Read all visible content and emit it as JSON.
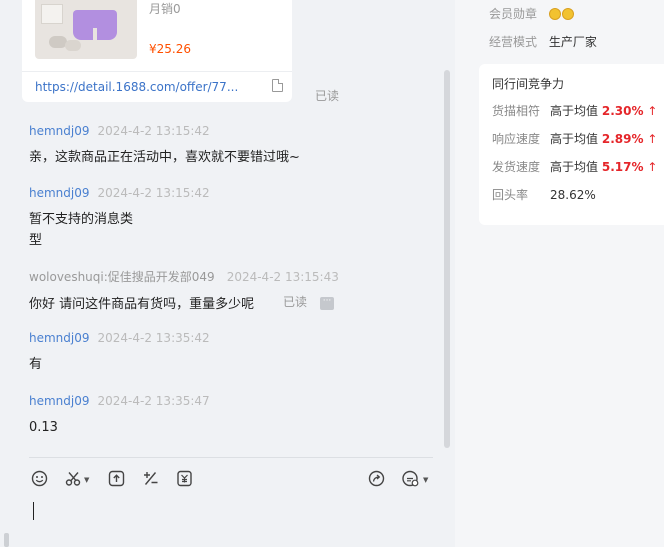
{
  "product": {
    "sales": "月销0",
    "price": "¥25.26",
    "link": "https://detail.1688.com/offer/77...",
    "read_status": "已读"
  },
  "messages": [
    {
      "sender": "hemndj09",
      "time": "2024-4-2 13:15:42",
      "text": "亲，这款商品正在活动中，喜欢就不要错过哦~"
    },
    {
      "sender": "hemndj09",
      "time": "2024-4-2 13:15:42",
      "text_line1": "暂不支持的消息类",
      "text_line2": "型"
    },
    {
      "sender": "woloveshuqi:促佳搜品开发部049",
      "time": "2024-4-2 13:15:43",
      "text": "你好 请问这件商品有货吗，重量多少呢",
      "read_status": "已读"
    },
    {
      "sender": "hemndj09",
      "time": "2024-4-2 13:35:42",
      "text": "有"
    },
    {
      "sender": "hemndj09",
      "time": "2024-4-2 13:35:47",
      "text": "0.13"
    }
  ],
  "toolbar": {
    "icons": [
      "emoji-icon",
      "scissors-icon",
      "upload-icon",
      "calculator-icon",
      "receipt-icon",
      "share-icon",
      "quick-reply-icon"
    ]
  },
  "seller_info": {
    "medal_label": "会员勋章",
    "mode_label": "经营模式",
    "mode_value": "生产厂家"
  },
  "competition": {
    "title": "同行间竞争力",
    "rows": [
      {
        "label": "货描相符",
        "desc": "高于均值",
        "value": "2.30%",
        "arrow": "↑"
      },
      {
        "label": "响应速度",
        "desc": "高于均值",
        "value": "2.89%",
        "arrow": "↑"
      },
      {
        "label": "发货速度",
        "desc": "高于均值",
        "value": "5.17%",
        "arrow": "↑"
      }
    ],
    "return_label": "回头率",
    "return_value": "28.62%"
  },
  "colors": {
    "price": "#ff5000",
    "link": "#3b73c8",
    "sender": "#4a80d0",
    "up_value": "#e5262a"
  }
}
